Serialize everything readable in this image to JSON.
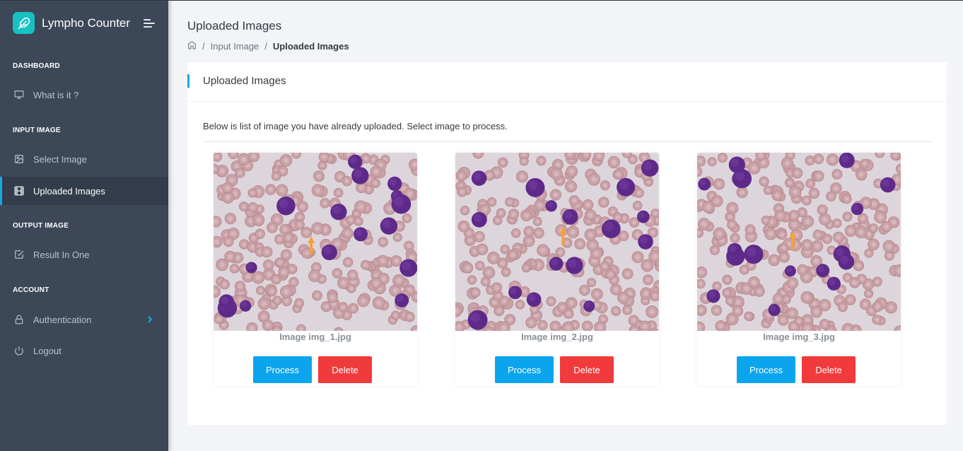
{
  "app": {
    "title": "Lympho Counter"
  },
  "sidebar": {
    "sections": [
      {
        "title": "DASHBOARD",
        "items": [
          {
            "label": "What is it ?",
            "icon": "monitor-icon"
          }
        ]
      },
      {
        "title": "INPUT IMAGE",
        "items": [
          {
            "label": "Select Image",
            "icon": "image-icon"
          },
          {
            "label": "Uploaded Images",
            "icon": "film-icon",
            "active": true
          }
        ]
      },
      {
        "title": "OUTPUT IMAGE",
        "items": [
          {
            "label": "Result In One",
            "icon": "checkbox-icon"
          }
        ]
      },
      {
        "title": "ACCOUNT",
        "items": [
          {
            "label": "Authentication",
            "icon": "lock-icon"
          },
          {
            "label": "Logout",
            "icon": "power-icon"
          }
        ]
      }
    ]
  },
  "header": {
    "title": "Uploaded Images",
    "breadcrumb": [
      "Input Image",
      "Uploaded Images"
    ]
  },
  "card": {
    "title": "Uploaded Images",
    "description": "Below is list of image you have already uploaded. Select image to process.",
    "images": [
      {
        "caption": "Image img_1.jpg",
        "process_label": "Process",
        "delete_label": "Delete"
      },
      {
        "caption": "Image img_2.jpg",
        "process_label": "Process",
        "delete_label": "Delete"
      },
      {
        "caption": "Image img_3.jpg",
        "process_label": "Process",
        "delete_label": "Delete"
      }
    ]
  },
  "colors": {
    "sidebar_bg": "#3c4858",
    "accent": "#17a9e0",
    "logo": "#17c1c1",
    "process_button": "#0aa5ec",
    "delete_button": "#f13a3b"
  }
}
